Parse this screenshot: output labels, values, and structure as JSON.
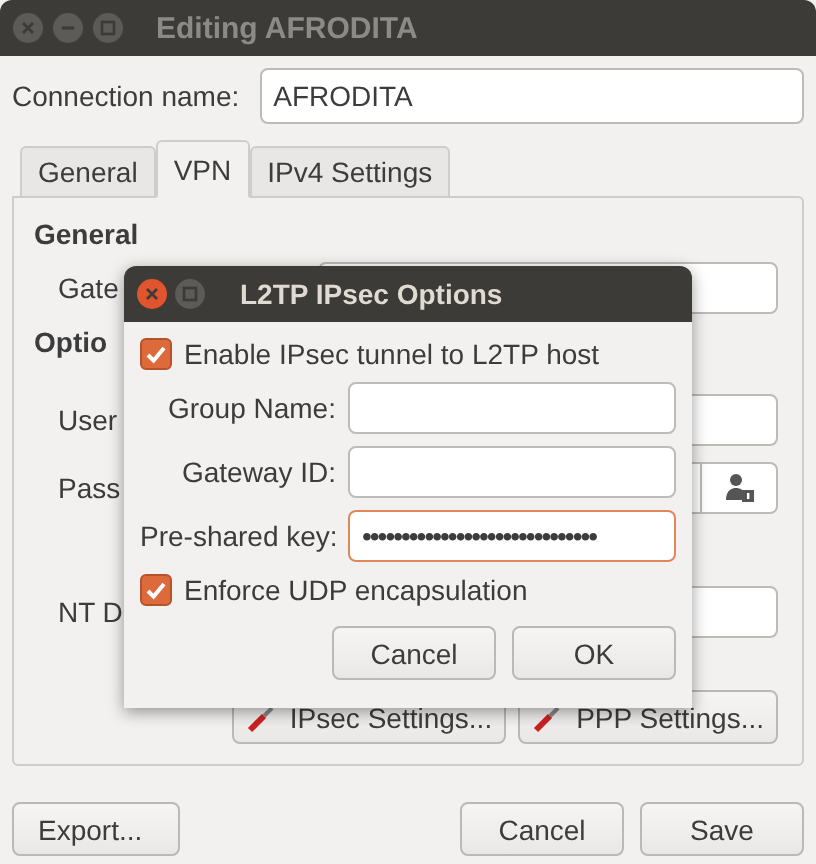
{
  "window": {
    "title": "Editing AFRODITA"
  },
  "connection_name": {
    "label": "Connection name:",
    "value": "AFRODITA"
  },
  "tabs": [
    {
      "label": "General",
      "selected": false
    },
    {
      "label": "VPN",
      "selected": true
    },
    {
      "label": "IPv4 Settings",
      "selected": false
    }
  ],
  "vpn": {
    "general_heading": "General",
    "gateway_label": "Gate",
    "options_heading": "Optio",
    "user_label": "User",
    "password_label": "Pass",
    "nt_domain_label": "NT D",
    "buttons": [
      "IPsec Settings...",
      "PPP Settings..."
    ]
  },
  "footer": {
    "export": "Export...",
    "cancel": "Cancel",
    "save": "Save"
  },
  "dialog": {
    "title": "L2TP IPsec Options",
    "enable": {
      "label": "Enable IPsec tunnel to L2TP host",
      "checked": true
    },
    "fields": [
      {
        "label": "Group Name:",
        "focused": false
      },
      {
        "label": "Gateway ID:",
        "focused": false
      },
      {
        "label": "Pre-shared key:",
        "value": "••••••••••••••••••••••••••••••",
        "focused": true
      }
    ],
    "udp": {
      "label": "Enforce UDP encapsulation",
      "checked": true
    },
    "buttons": [
      "Cancel",
      "OK"
    ]
  }
}
